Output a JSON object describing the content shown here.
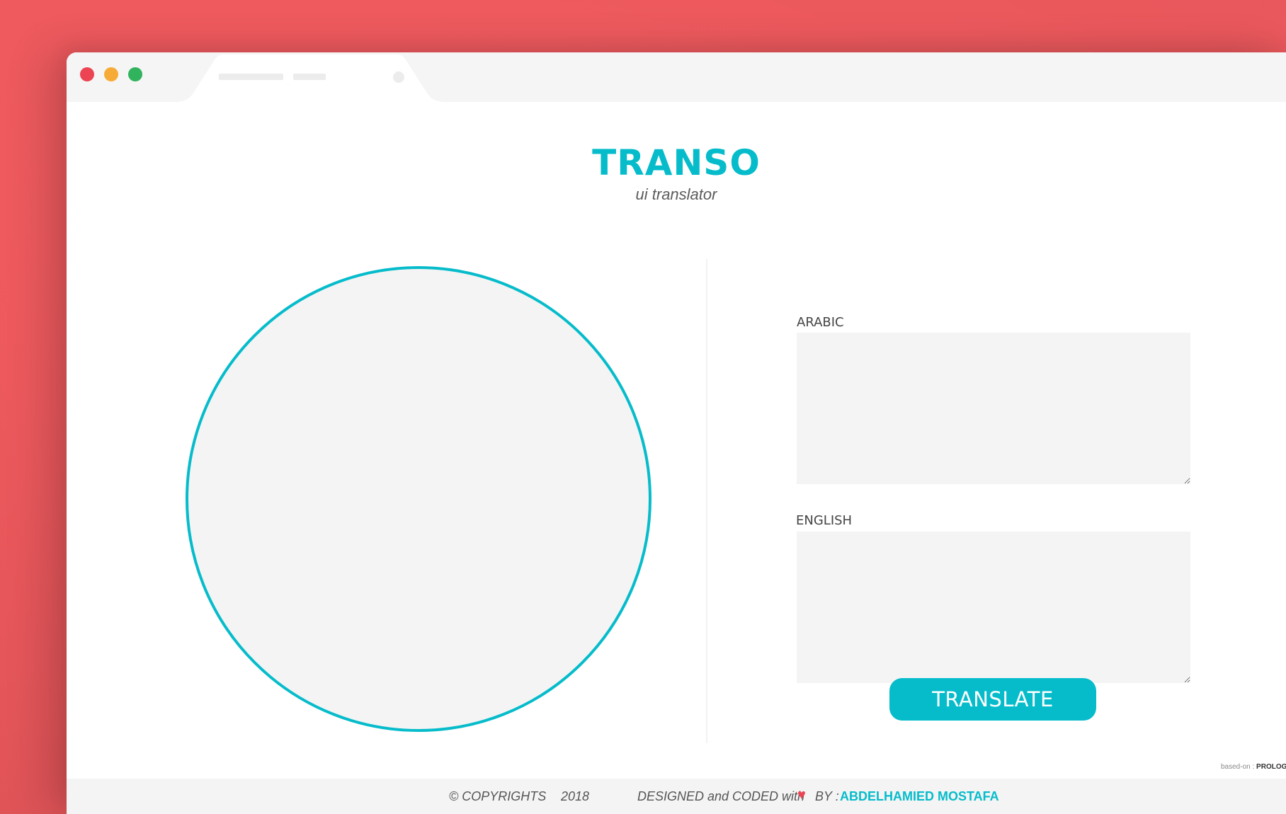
{
  "app": {
    "title": "TRANSO",
    "subtitle": "ui translator"
  },
  "colors": {
    "background": "#f45c60",
    "accent": "#06bccb",
    "window_dot_red": "#ec4452",
    "window_dot_yellow": "#f7ab37",
    "window_dot_green": "#31b25d",
    "panel_fill": "#f4f4f4"
  },
  "form": {
    "arabic_label": "ARABIC",
    "arabic_value": "",
    "english_label": "ENGLISH",
    "english_value": "",
    "translate_label": "TRANSLATE"
  },
  "voice_circle": {
    "icon": "record-circle-icon"
  },
  "based_on": {
    "prefix": "based-on :",
    "name": "PROLOG"
  },
  "footer": {
    "copyright": "© COPYRIGHTS",
    "year": "2018",
    "designed_text": "DESIGNED and CODED with",
    "heart_icon": "heart-icon",
    "by_text": "BY :",
    "author": "ABDELHAMIED MOSTAFA"
  }
}
